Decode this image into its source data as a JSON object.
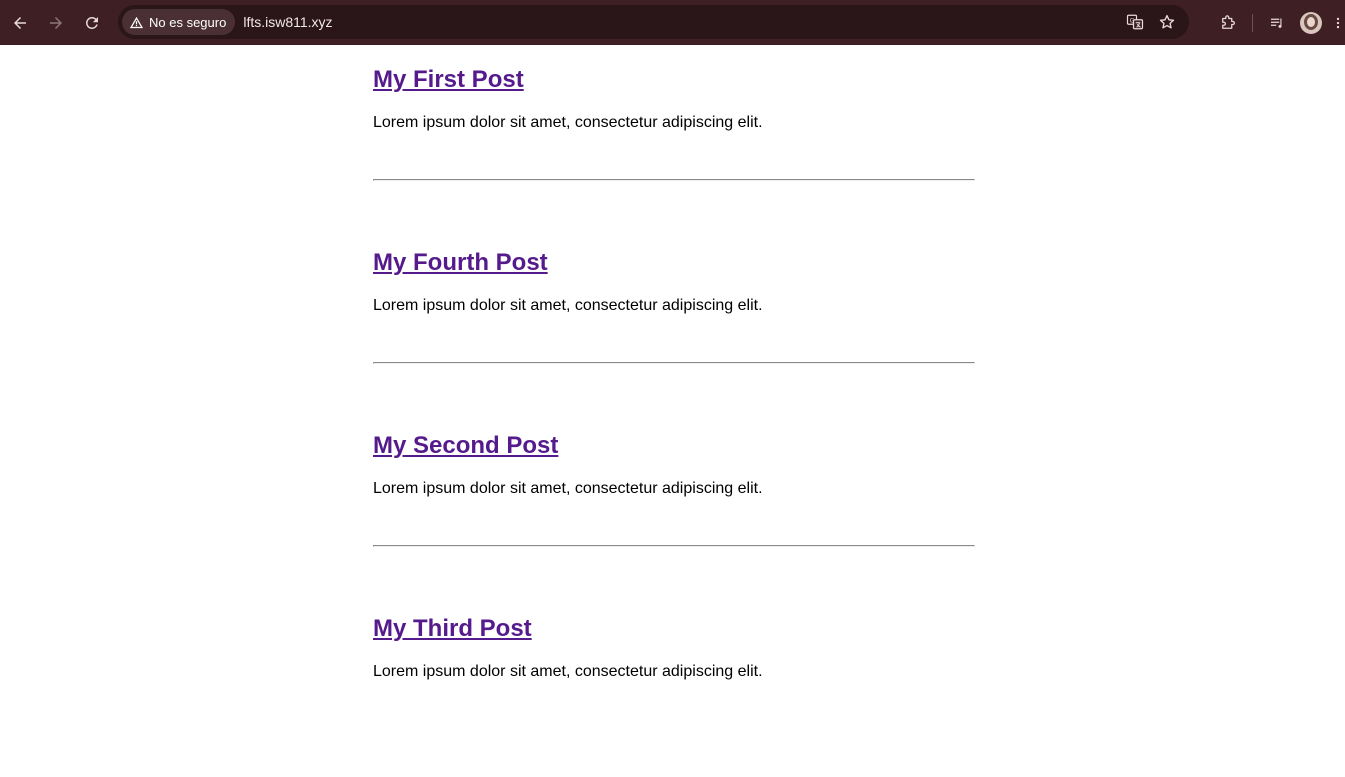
{
  "browser": {
    "security_label": "No es seguro",
    "url": "lfts.isw811.xyz",
    "icons": {
      "back": "back-arrow-icon",
      "forward": "forward-arrow-icon",
      "reload": "reload-icon",
      "warning": "warning-icon",
      "translate": "translate-icon",
      "bookmark": "star-icon",
      "extensions": "puzzle-icon",
      "reading_list": "reading-list-icon",
      "profile": "avatar",
      "menu": "more-vert-icon"
    },
    "colors": {
      "toolbar": "#3d1f24",
      "omnibox": "#2a1518"
    }
  },
  "posts": [
    {
      "title": "My First Post",
      "excerpt": "Lorem ipsum dolor sit amet, consectetur adipiscing elit."
    },
    {
      "title": "My Fourth Post",
      "excerpt": "Lorem ipsum dolor sit amet, consectetur adipiscing elit."
    },
    {
      "title": "My Second Post",
      "excerpt": "Lorem ipsum dolor sit amet, consectetur adipiscing elit."
    },
    {
      "title": "My Third Post",
      "excerpt": "Lorem ipsum dolor sit amet, consectetur adipiscing elit."
    }
  ],
  "colors": {
    "link_visited": "#551a8b",
    "divider": "#8a8a8a"
  }
}
